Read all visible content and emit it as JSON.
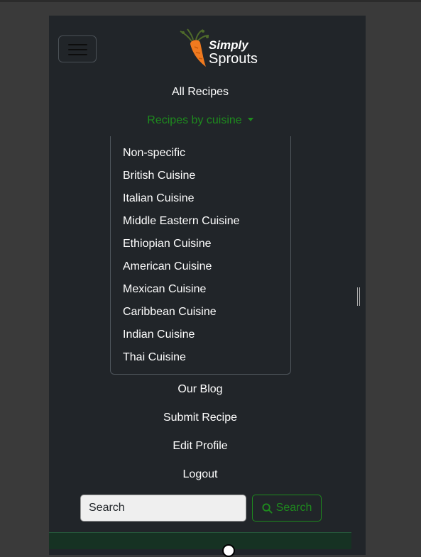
{
  "brand": {
    "line1": "Simply",
    "line2": "Sprouts"
  },
  "nav": {
    "all_recipes": "All Recipes",
    "by_cuisine": "Recipes by cuisine",
    "blog": "Our Blog",
    "submit": "Submit Recipe",
    "edit_profile": "Edit Profile",
    "logout": "Logout"
  },
  "cuisines": [
    "Non-specific",
    "British Cuisine",
    "Italian Cuisine",
    "Middle Eastern Cuisine",
    "Ethiopian Cuisine",
    "American Cuisine",
    "Mexican Cuisine",
    "Caribbean Cuisine",
    "Indian Cuisine",
    "Thai Cuisine"
  ],
  "search": {
    "placeholder": "Search",
    "button_label": "Search"
  },
  "colors": {
    "accent": "#1e8a1e",
    "navbar_bg": "#212529"
  }
}
